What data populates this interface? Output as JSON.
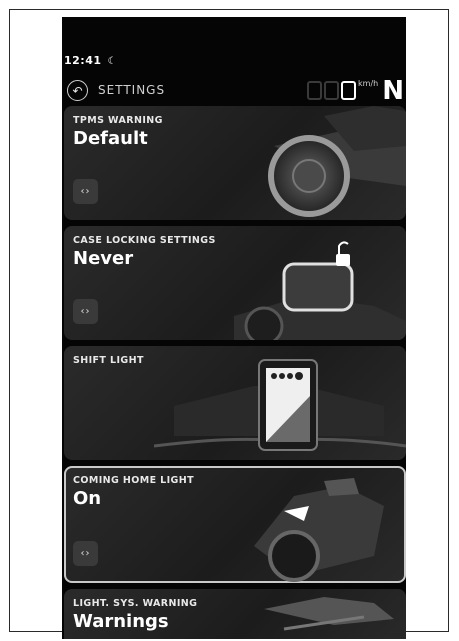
{
  "status": {
    "time": "12:41"
  },
  "header": {
    "back_glyph": "↶",
    "title": "SETTINGS"
  },
  "speedometer": {
    "unit": "km/h",
    "gear": "N"
  },
  "cards": [
    {
      "label": "TPMS WARNING",
      "value": "Default",
      "arrows": "‹›"
    },
    {
      "label": "CASE LOCKING SETTINGS",
      "value": "Never",
      "arrows": "‹›"
    },
    {
      "label": "SHIFT LIGHT"
    },
    {
      "label": "COMING HOME LIGHT",
      "value": "On",
      "arrows": "‹›"
    },
    {
      "label": "LIGHT. SYS. WARNING",
      "value": "Warnings"
    }
  ]
}
